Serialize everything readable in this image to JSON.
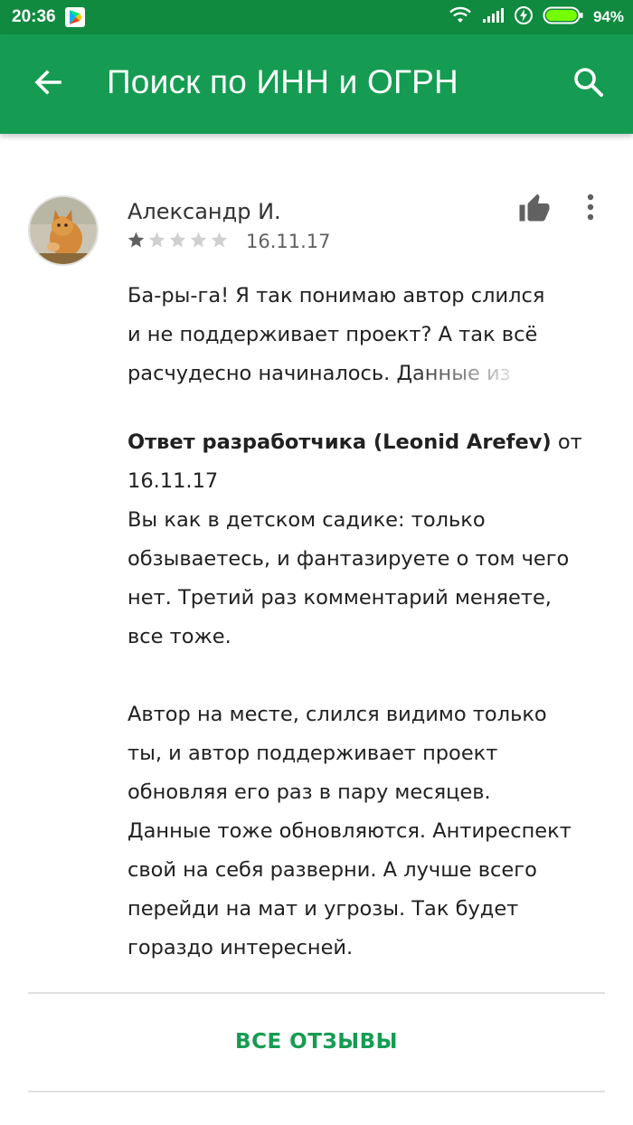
{
  "status_bar": {
    "time": "20:36",
    "battery": "94%",
    "icons": [
      "play-store-icon",
      "wifi-icon",
      "signal-icon",
      "charging-icon",
      "battery-icon"
    ]
  },
  "app_bar": {
    "title": "Поиск по ИНН и ОГРН",
    "color": "#159c52",
    "icons": [
      "back-arrow-icon",
      "search-icon"
    ]
  },
  "review": {
    "author": "Александр И.",
    "rating": 1,
    "max_rating": 5,
    "date": "16.11.17",
    "text_lines": [
      "Ба-ры-га! Я так понимаю автор слился",
      "и не поддерживает проект? А так всё",
      "расчудесно начиналось. Данные из"
    ],
    "icons": [
      "avatar-cat",
      "thumbs-up-icon",
      "more-vert-icon"
    ]
  },
  "developer_reply": {
    "label": "Ответ разработчика (Leonid Arefev)",
    "from_word": "от",
    "date": "16.11.17",
    "paragraph1": [
      "Вы как в детском садике: только",
      "обзываетесь, и фантазируете о том чего",
      "нет. Третий раз комментарий меняете,",
      "все тоже."
    ],
    "paragraph2": [
      "Автор на месте, слился видимо только",
      "ты, и автор поддерживает проект",
      "обновляя его раз в пару месяцев.",
      "Данные тоже обновляются. Антиреспект",
      "свой на себя разверни. А лучше всего",
      "перейди на мат и угрозы. Так будет",
      "гораздо интересней."
    ]
  },
  "footer": {
    "all_reviews": "ВСЕ ОТЗЫВЫ"
  }
}
